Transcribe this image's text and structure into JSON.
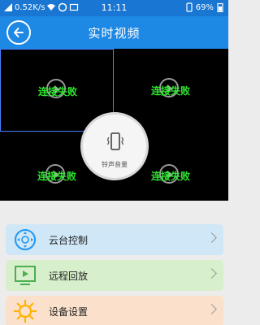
{
  "status_bar": {
    "network_speed": "0.52K/s",
    "time": "11:11",
    "battery": "69%"
  },
  "header": {
    "title": "实时视频"
  },
  "video_grid": {
    "cells": [
      {
        "status": "连接失败",
        "selected": true
      },
      {
        "status": "连接失败",
        "selected": false
      },
      {
        "status": "连接失败",
        "selected": false
      },
      {
        "status": "连接失败",
        "selected": false
      }
    ]
  },
  "ring_button": {
    "label": "铃声音量",
    "icon": "phone-vibrate-icon"
  },
  "menu": [
    {
      "label": "云台控制",
      "icon": "ptz-control-icon",
      "bg": "#cfe7f7",
      "icon_color": "#2196f3"
    },
    {
      "label": "远程回放",
      "icon": "playback-icon",
      "bg": "#d7efcb",
      "icon_color": "#4caf50"
    },
    {
      "label": "设备设置",
      "icon": "settings-sun-icon",
      "bg": "#fbe1cc",
      "icon_color": "#ffb300"
    }
  ],
  "colors": {
    "header_bg": "#1e88e5",
    "status_bar_bg": "#1976d2",
    "fail_text": "#2ee62e"
  }
}
